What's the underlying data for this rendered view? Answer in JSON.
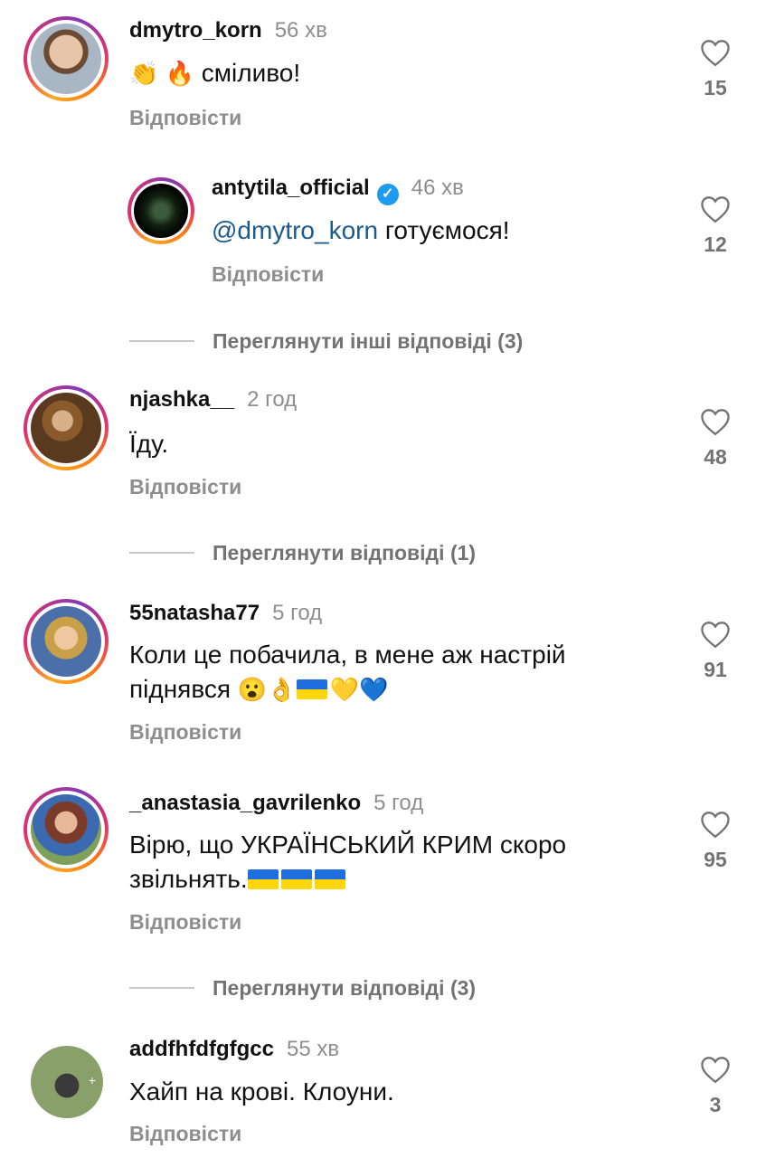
{
  "comments": [
    {
      "username": "dmytro_korn",
      "time": "56 хв",
      "text": "сміливо!",
      "emoji_prefix": "👏 🔥",
      "reply": "Відповісти",
      "likes": "15"
    },
    {
      "username": "antytila_official",
      "time": "46 хв",
      "mention": "@dmytro_korn",
      "text": "готуємося!",
      "reply": "Відповісти",
      "likes": "12",
      "verified": true
    },
    {
      "username": "njashka__",
      "time": "2 год",
      "text": "Їду.",
      "reply": "Відповісти",
      "likes": "48"
    },
    {
      "username": "55natasha77",
      "time": "5 год",
      "text_line1": "Коли це побачила, в мене аж настрій",
      "text_line2": "піднявся",
      "emoji_suffix": "😮👌",
      "hearts": "💛💙",
      "reply": "Відповісти",
      "likes": "91"
    },
    {
      "username": "_anastasia_gavrilenko",
      "time": "5 год",
      "text_line1": "Вірю, що УКРАЇНСЬКИЙ КРИМ скоро",
      "text_line2": "звільнять.",
      "reply": "Відповісти",
      "likes": "95"
    },
    {
      "username": "addfhfdfgfgcc",
      "time": "55 хв",
      "text": "Хайп на крові. Клоуни.",
      "reply": "Відповісти",
      "likes": "3"
    }
  ],
  "view_replies": [
    "Переглянути інші відповіді (3)",
    "Переглянути відповіді (1)",
    "Переглянути відповіді (3)"
  ],
  "colors": {
    "mention": "#1a5b8e",
    "muted": "#8e8e8e",
    "verified": "#1d9bf0"
  },
  "icons": {
    "like": "heart-outline-icon",
    "verified": "verified-badge-icon"
  }
}
